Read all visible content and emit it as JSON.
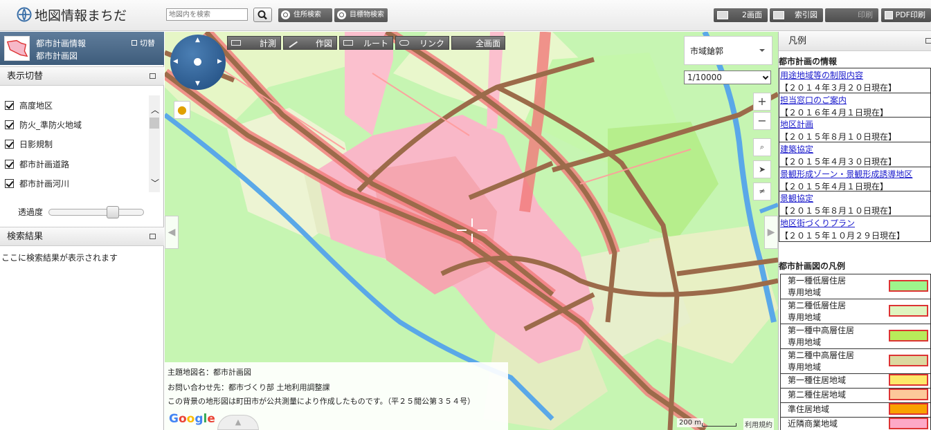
{
  "header": {
    "site_title": "地図情報まちだ",
    "search_placeholder": "地図内を検索",
    "address_search": "住所検索",
    "landmark_search": "目標物検索",
    "two_screen": "2画面",
    "index_map": "索引図",
    "print": "印刷",
    "pdf_print": "PDF印刷"
  },
  "layer": {
    "name_line1": "都市計画情報",
    "name_line2": "都市計画図",
    "switch_label": "切替"
  },
  "display_toggle": {
    "title": "表示切替",
    "items": [
      {
        "label": "高度地区",
        "checked": true
      },
      {
        "label": "防火_準防火地域",
        "checked": true
      },
      {
        "label": "日影規制",
        "checked": true
      },
      {
        "label": "都市計画道路",
        "checked": true
      },
      {
        "label": "都市計画河川",
        "checked": true
      }
    ],
    "opacity_label": "透過度",
    "opacity_value": 0.7
  },
  "search_results": {
    "title": "検索結果",
    "placeholder_text": "ここに検索結果が表示されます"
  },
  "map": {
    "tools": {
      "measure": "計測",
      "draw": "作図",
      "route": "ルート",
      "link": "リンク",
      "fullscreen": "全画面"
    },
    "area_select": "市域鎗郭",
    "scale_select": "1/10000",
    "info_lines": [
      "主題地図名：都市計画図",
      "お問い合わせ先：都市づくり部 土地利用調整課",
      "この背景の地形図は町田市が公共測量により作成したものです。（平２５閲公第３５４号）"
    ],
    "google_logo": [
      "G",
      "o",
      "o",
      "g",
      "l",
      "e"
    ],
    "scale_label": "200 m",
    "terms": "利用規約"
  },
  "legend": {
    "title": "凡例",
    "info_heading": "都市計画の情報",
    "info_items": [
      {
        "link": "用途地域等の制限内容",
        "date": "【２０１４年３月２０日現在】"
      },
      {
        "link": "担当窓口のご案内",
        "date": "【２０１６年４月１日現在】"
      },
      {
        "link": "地区計画",
        "date": "【２０１５年８月１０日現在】"
      },
      {
        "link": "建築協定",
        "date": "【２０１５年４月３０日現在】"
      },
      {
        "link": "景観形成ゾーン・景観形成誘導地区",
        "date": "【２０１５年４月１日現在】"
      },
      {
        "link": "景観協定",
        "date": "【２０１５年８月１０日現在】"
      },
      {
        "link": "地区街づくりプラン",
        "date": "【２０１５年１０月２９日現在】"
      }
    ],
    "map_legend_heading": "都市計画図の凡例",
    "map_legend": [
      {
        "name": [
          "第一種低層住居",
          "専用地域"
        ],
        "color": "#9ef58c"
      },
      {
        "name": [
          "第二種低層住居",
          "専用地域"
        ],
        "color": "#dff5c0"
      },
      {
        "name": [
          "第一種中高層住居",
          "専用地域"
        ],
        "color": "#b8ec5a"
      },
      {
        "name": [
          "第二種中高層住居",
          "専用地域"
        ],
        "color": "#dcd9a0"
      },
      {
        "name": [
          "第一種住居地域"
        ],
        "color": "#fde86a"
      },
      {
        "name": [
          "第二種住居地域"
        ],
        "color": "#fcc89a"
      },
      {
        "name": [
          "準住居地域"
        ],
        "color": "#f9a100"
      },
      {
        "name": [
          "近隣商業地域"
        ],
        "color": "#fda9c7"
      }
    ]
  }
}
